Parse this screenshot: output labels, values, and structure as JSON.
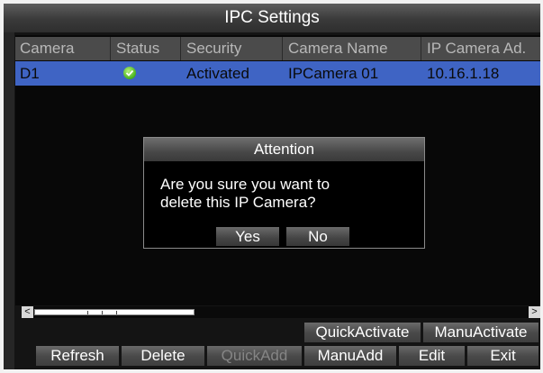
{
  "window": {
    "title": "IPC Settings"
  },
  "table": {
    "columns": [
      "Camera",
      "Status",
      "Security",
      "Camera Name",
      "IP Camera Ad."
    ],
    "rows": [
      {
        "camera": "D1",
        "status_icon": "check-circle-icon",
        "security": "Activated",
        "camera_name": "IPCamera 01",
        "ip": "10.16.1.18"
      }
    ]
  },
  "dialog": {
    "title": "Attention",
    "line1": "Are you sure you want to",
    "line2": "delete this IP Camera?",
    "yes_label": "Yes",
    "no_label": "No"
  },
  "scrollbar": {
    "left_arrow": "<",
    "right_arrow": ">"
  },
  "activate_buttons": {
    "quick_activate": "QuickActivate",
    "manu_activate": "ManuActivate"
  },
  "bottom_buttons": {
    "refresh": "Refresh",
    "delete": "Delete",
    "quick_add": "QuickAdd",
    "manu_add": "ManuAdd",
    "edit": "Edit",
    "exit": "Exit"
  },
  "colors": {
    "selected_row": "#3f64c4",
    "status_ok": "#45b21c",
    "disabled_text": "#858585"
  }
}
